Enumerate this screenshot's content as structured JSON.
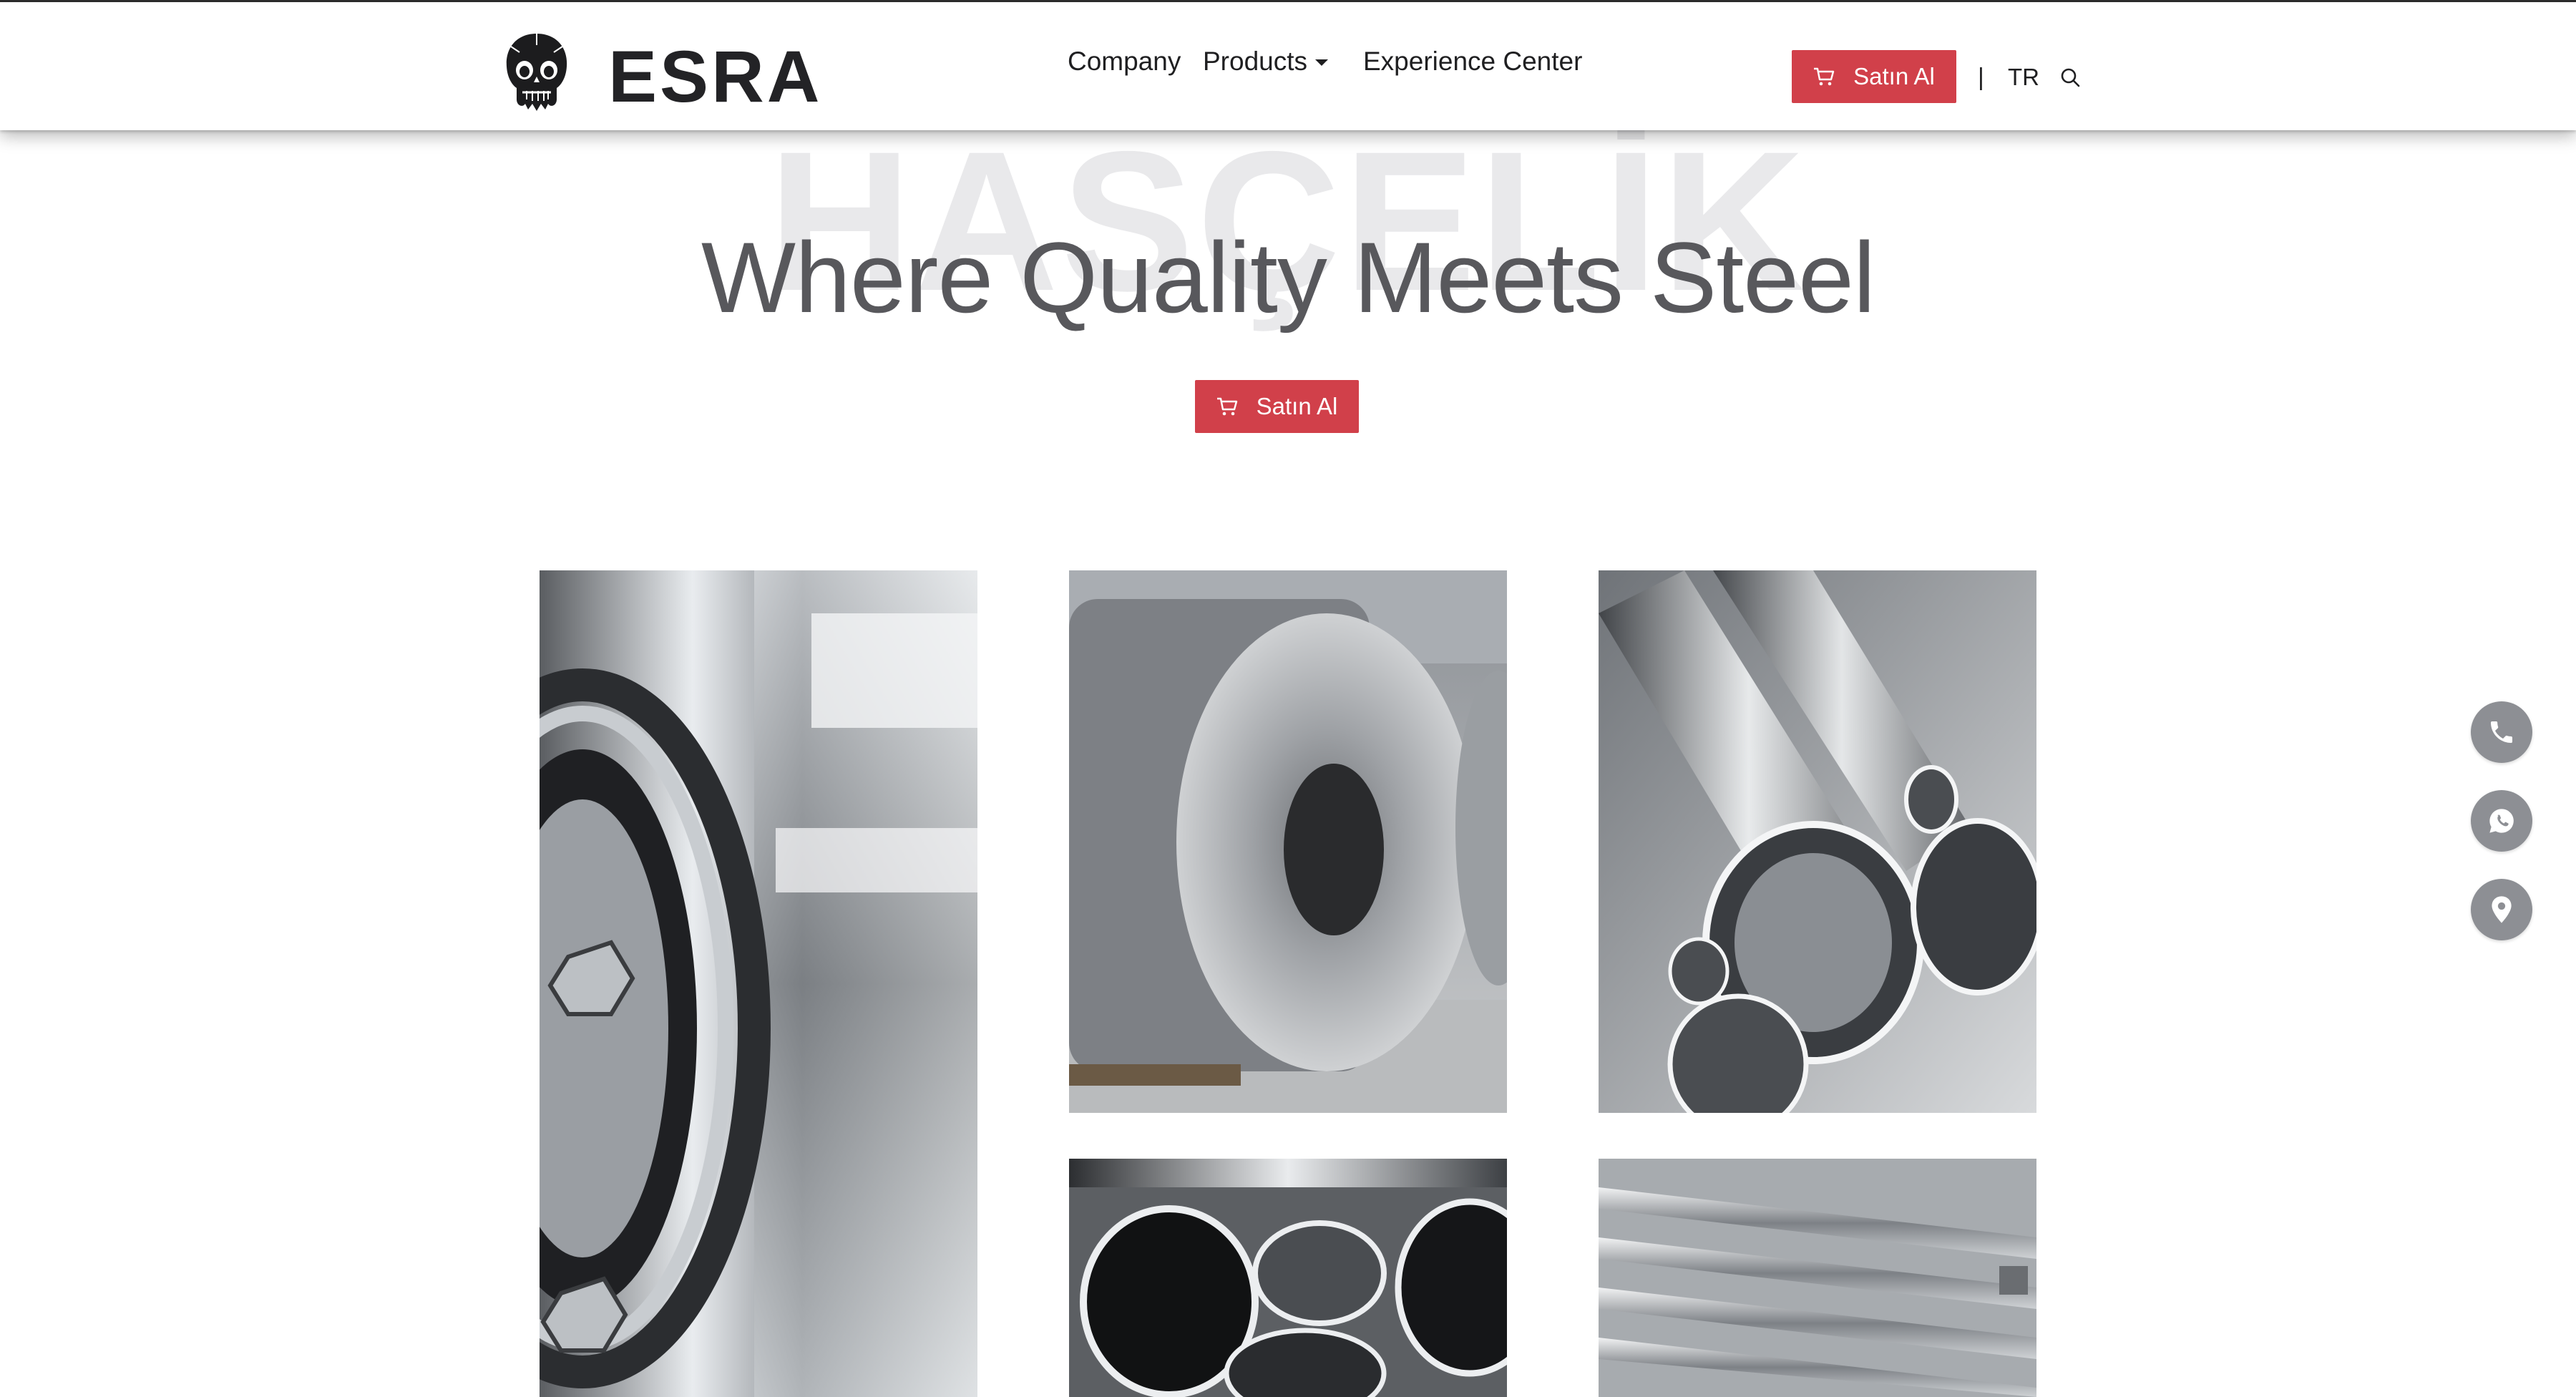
{
  "header": {
    "brand": "ESRA",
    "nav": {
      "company": "Company",
      "products": "Products",
      "experience_center": "Experience Center"
    },
    "buy_label": "Satın Al",
    "separator": "|",
    "language": "TR"
  },
  "hero": {
    "watermark": "HASÇELİK",
    "title": "Where Quality Meets Steel",
    "buy_label": "Satın Al"
  },
  "gallery": {
    "images": [
      "industrial-pipe-flange",
      "steel-coils",
      "stainless-steel-tubes",
      "polished-steel-pipes",
      "steel-bars"
    ]
  },
  "floating_contacts": [
    "phone-icon",
    "whatsapp-icon",
    "location-pin-icon"
  ],
  "colors": {
    "accent": "#d1404a",
    "title_text": "#58585c",
    "watermark": "#e9e9eb",
    "floating_button": "#8d8f94"
  }
}
